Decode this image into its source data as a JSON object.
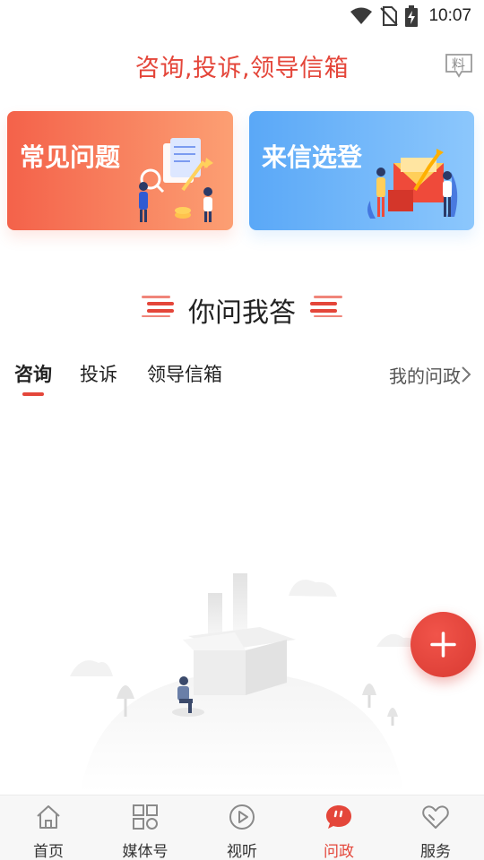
{
  "status_bar": {
    "time": "10:07"
  },
  "header": {
    "title": "咨询,投诉,领导信箱",
    "badge_text": "料"
  },
  "cards": [
    {
      "label": "常见问题",
      "color_start": "#f4624a",
      "color_end": "#fc9f73"
    },
    {
      "label": "来信选登",
      "color_start": "#5aa8f7",
      "color_end": "#8cc7fc"
    }
  ],
  "section": {
    "title": "你问我答"
  },
  "tabs": [
    {
      "label": "咨询",
      "active": true
    },
    {
      "label": "投诉",
      "active": false
    },
    {
      "label": "领导信箱",
      "active": false
    }
  ],
  "my_link": {
    "label": "我的问政"
  },
  "fab": {
    "icon": "plus-icon"
  },
  "bottom_nav": [
    {
      "label": "首页",
      "icon": "home-icon",
      "active": false
    },
    {
      "label": "媒体号",
      "icon": "grid-icon",
      "active": false
    },
    {
      "label": "视听",
      "icon": "play-icon",
      "active": false
    },
    {
      "label": "问政",
      "icon": "chat-bubble-icon",
      "active": true
    },
    {
      "label": "服务",
      "icon": "heart-icon",
      "active": false
    }
  ],
  "colors": {
    "accent": "#e4463a",
    "text": "#222222",
    "nav_bg": "#f7f7f7"
  }
}
